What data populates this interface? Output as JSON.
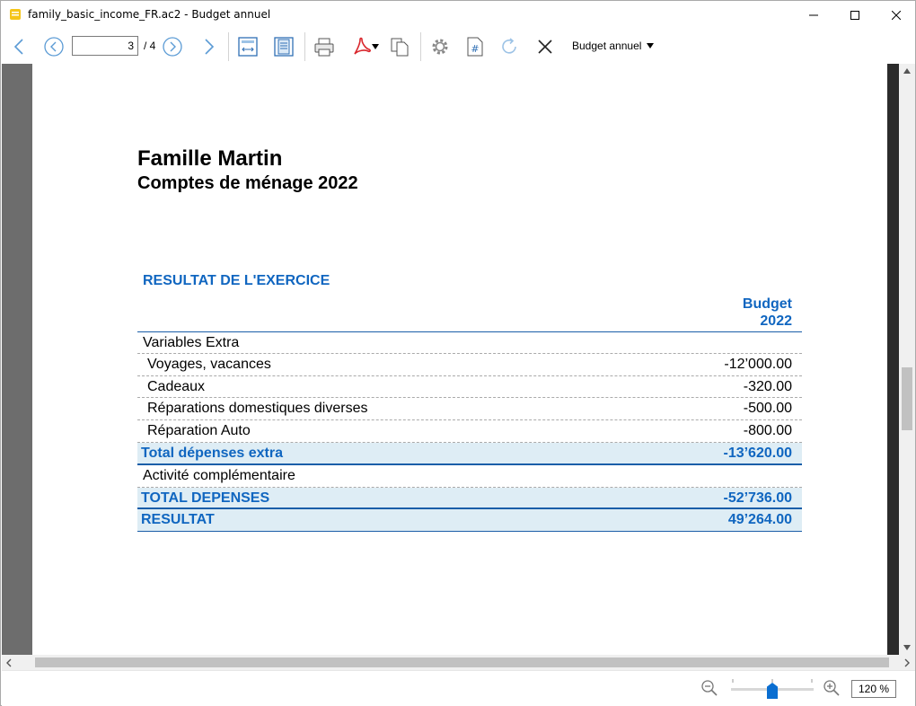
{
  "window": {
    "title": "family_basic_income_FR.ac2 - Budget annuel"
  },
  "toolbar": {
    "page_current": "3",
    "page_total": "/ 4",
    "report_selector": "Budget annuel"
  },
  "report": {
    "title": "Famille Martin",
    "subtitle": "Comptes de ménage 2022",
    "section": "RESULTAT DE L'EXERCICE",
    "column_header_line1": "Budget",
    "column_header_line2": "2022",
    "rows": [
      {
        "label": "Variables Extra",
        "amount": "",
        "kind": "group"
      },
      {
        "label": "Voyages, vacances",
        "amount": "-12’000.00",
        "kind": "item"
      },
      {
        "label": "Cadeaux",
        "amount": "-320.00",
        "kind": "item"
      },
      {
        "label": "Réparations domestiques diverses",
        "amount": "-500.00",
        "kind": "item"
      },
      {
        "label": "Réparation Auto",
        "amount": "-800.00",
        "kind": "item"
      },
      {
        "label": "Total dépenses extra",
        "amount": "-13’620.00",
        "kind": "total"
      },
      {
        "label": "Activité complémentaire",
        "amount": "",
        "kind": "group"
      },
      {
        "label": "TOTAL DEPENSES",
        "amount": "-52’736.00",
        "kind": "total"
      },
      {
        "label": "RESULTAT",
        "amount": "49’264.00",
        "kind": "total"
      }
    ]
  },
  "statusbar": {
    "zoom": "120 %",
    "zoom_level_percent": 120
  },
  "colors": {
    "accent_blue": "#1066c0",
    "total_row_bg": "#deedf5",
    "page_bg": "#6d6d6d"
  }
}
